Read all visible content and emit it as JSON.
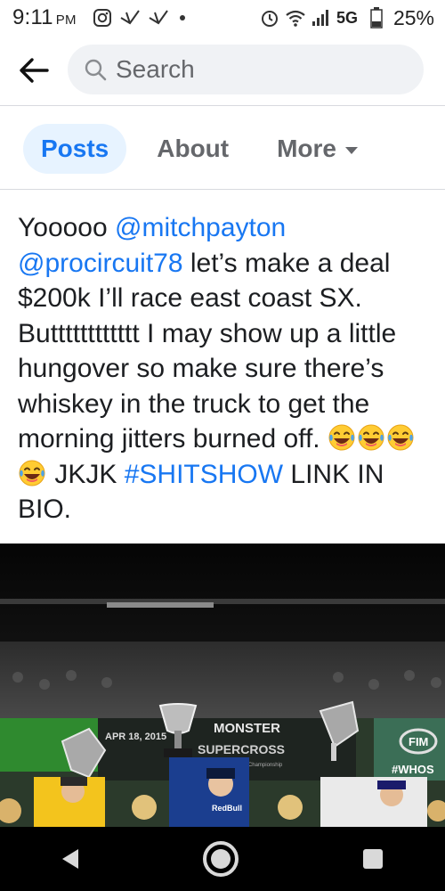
{
  "status_bar": {
    "time": "9:11",
    "ampm": "PM",
    "network": "5G",
    "battery": "25%",
    "icons": [
      "instagram-icon",
      "bird-notification-icon",
      "bird-notification-icon",
      "dot-icon",
      "alarm-icon",
      "wifi-icon",
      "signal-icon",
      "battery-icon"
    ]
  },
  "header": {
    "back_icon": "arrow-left-icon",
    "search_icon": "search-icon",
    "search_placeholder": "Search"
  },
  "tabs": [
    {
      "label": "Posts",
      "active": true
    },
    {
      "label": "About",
      "active": false
    },
    {
      "label": "More",
      "active": false
    }
  ],
  "post": {
    "line1": "Yooooo ",
    "mention1": "@mitchpayton",
    "mention2": "@procircuit78",
    "text2": " let’s make a deal $200k I’ll race east coast SX. Butttttttttttt I may show up a little hungover so make sure there’s whiskey in the truck to get the morning jitters burned off. ",
    "text3": " JKJK",
    "hashtag": "#SHITSHOW",
    "text4": " LINK IN BIO.",
    "emoji": "face-with-tears-of-joy-icon",
    "emoji_count": 4
  },
  "media": {
    "banner_brand": "MONSTER",
    "banner_event": "SUPERCROSS",
    "banner_date": "APR 18, 2015",
    "banner_sub": "SX World Championship",
    "banner_right": "FIM",
    "banner_right2": "#WHOS"
  },
  "nav": {
    "back": "nav-back-icon",
    "home": "nav-home-icon",
    "recents": "nav-recents-icon"
  },
  "colors": {
    "link": "#1877f2",
    "tab_active_bg": "#e7f3ff",
    "search_bg": "#f0f2f5"
  }
}
